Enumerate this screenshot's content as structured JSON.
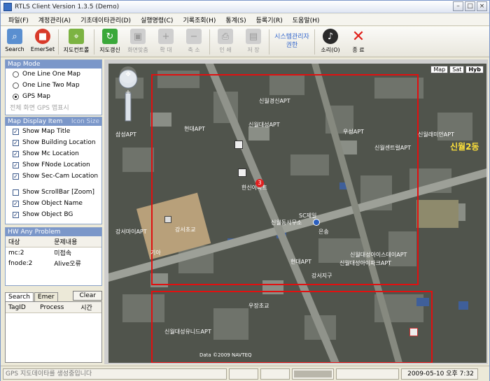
{
  "window": {
    "title": "RTLS Client Version 1.3.5 (Demo)"
  },
  "menu": [
    "파일(F)",
    "계정관리(A)",
    "기초데이타관리(D)",
    "실행명령(C)",
    "기록조회(H)",
    "통계(S)",
    "등록기(R)",
    "도움말(H)"
  ],
  "toolbar": {
    "search": "Search",
    "emerset": "EmerSet",
    "mapcontrol": "지도컨트롤",
    "mapupdate": "지도갱신",
    "fitscreen": "화면맞춤",
    "zoomin": "확 대",
    "zoomout": "축 소",
    "print": "인 쇄",
    "save": "저 장",
    "admin_line1": "시스템관리자",
    "admin_line2": "권한",
    "sound": "소리(O)",
    "exit": "종 료"
  },
  "mapmode": {
    "header": "Map Mode",
    "opt1": "One Line One Map",
    "opt2": "One Line Two Map",
    "opt3": "GPS Map",
    "disabled": "전체 화면 GPS 맵표시"
  },
  "display": {
    "header": "Map Display Item",
    "extra": "Icon Size",
    "items": [
      "Show Map Title",
      "Show Building Location",
      "Show Mc Location",
      "Show FNode Location",
      "Show Sec-Cam Location",
      "Show ScrollBar [Zoom]",
      "Show Object Name",
      "Show Object BG"
    ]
  },
  "problem": {
    "header": "HW Any Problem",
    "col1": "대상",
    "col2": "문제내용",
    "rows": [
      [
        "mc:2",
        "미접속"
      ],
      [
        "fnode:2",
        "Alive오류"
      ]
    ]
  },
  "searchpanel": {
    "tab1": "Search",
    "tab2": "Emer",
    "clear": "Clear",
    "col1": "TagID",
    "col2": "Process",
    "col3": "시간"
  },
  "map": {
    "btn_map": "Map",
    "btn_sat": "Sat",
    "btn_hyb": "Hyb",
    "district": "신월2동",
    "copyright": "Data ©2009 NAVTEQ",
    "labels": [
      "신월대성유니드APT",
      "신월대성APT",
      "현대APT",
      "신월경신APT",
      "한신아파트",
      "삼성APT",
      "강서초교",
      "강서마이APT",
      "현대APT",
      "우성APT",
      "신월센트럴APT",
      "신월래미안APT",
      "SC제일",
      "신월동사무소",
      "신월대성아이스데이APT",
      "강서지구",
      "신월대성아이파크APT",
      "은송",
      "기아",
      "우장초교"
    ]
  },
  "status": {
    "message": "GPS 지도데이타를 생성중입니다",
    "datetime": "2009-05-10 오후 7:32"
  },
  "colors": {
    "titlebar": "#dfe6f3",
    "groupHeader": "#7b97c9",
    "accentText": "#3366cc",
    "mapRect": "#e01010"
  }
}
